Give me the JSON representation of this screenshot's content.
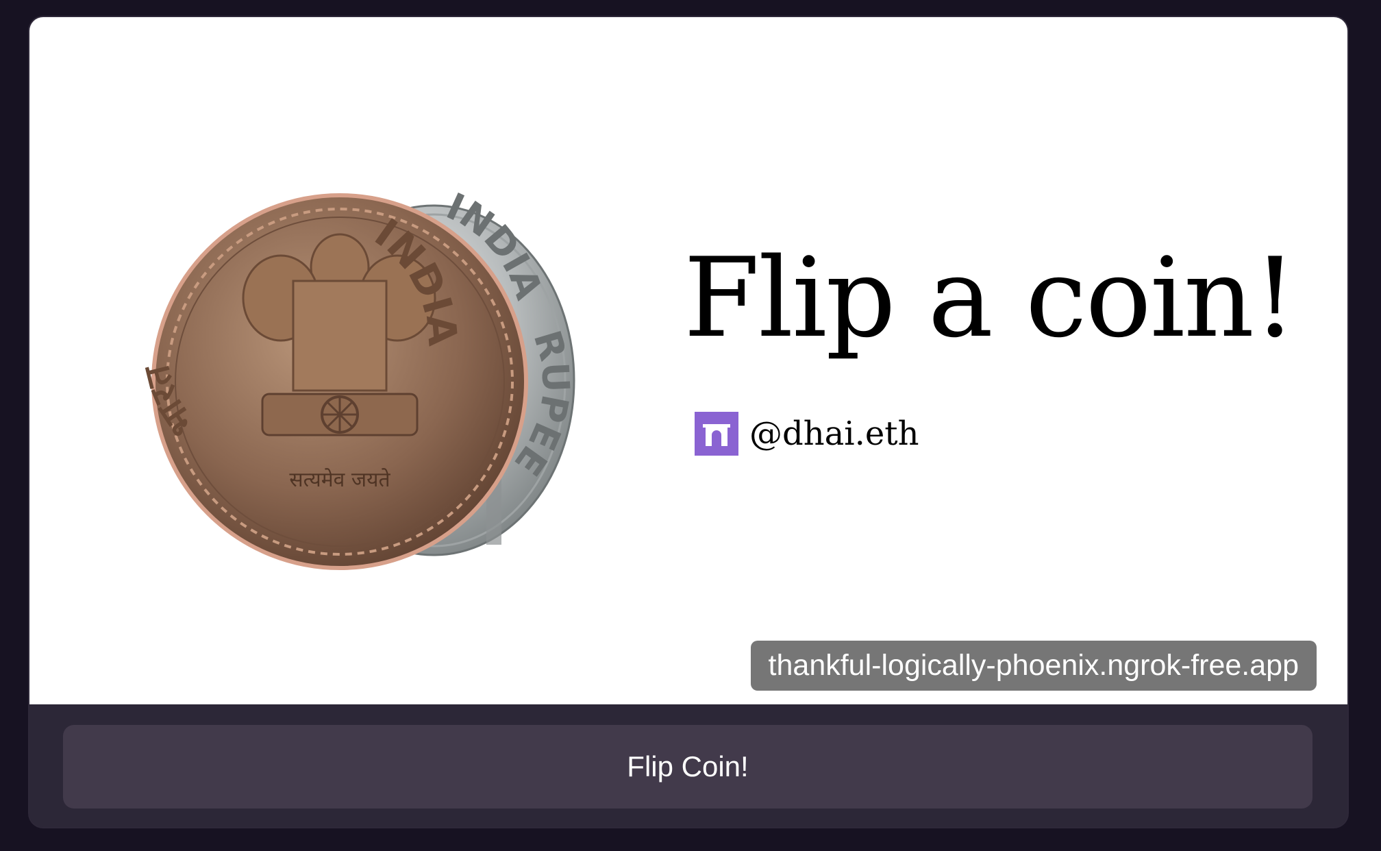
{
  "frame": {
    "title": "Flip a coin!",
    "author": "@dhai.eth",
    "url": "thankful-logically-phoenix.ngrok-free.app",
    "button_label": "Flip Coin!"
  },
  "coins": {
    "front": {
      "left_legend": "भारत",
      "right_legend": "INDIA",
      "motto": "सत्यमेव जयते"
    },
    "back": {
      "top_legend": "INDIA",
      "bottom_legend": "RUPEE"
    }
  },
  "colors": {
    "page_background": "#171222",
    "card_footer": "#2c2737",
    "button": "#423a4b",
    "url_pill": "#767676",
    "author_badge": "#8a63d2"
  },
  "icons": {
    "author_badge": "farcaster-arch-icon"
  }
}
